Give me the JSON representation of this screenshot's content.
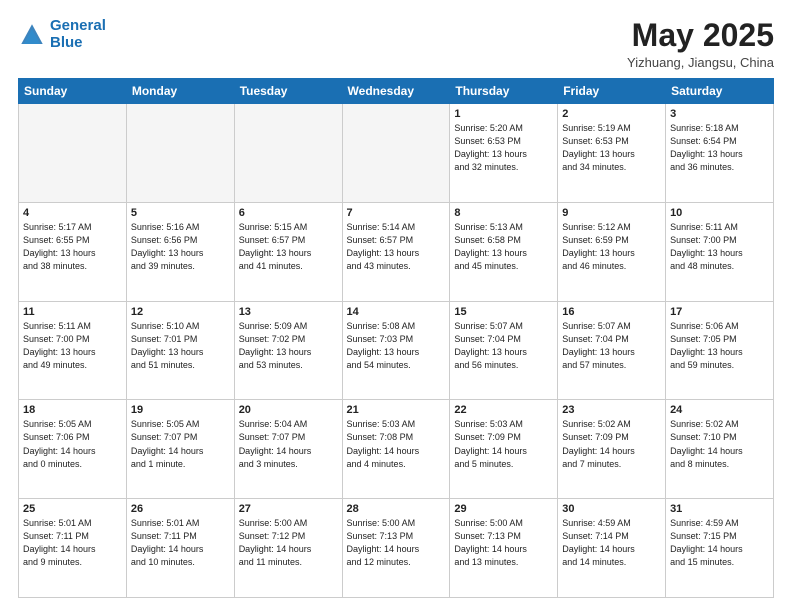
{
  "logo": {
    "line1": "General",
    "line2": "Blue"
  },
  "title": "May 2025",
  "subtitle": "Yizhuang, Jiangsu, China",
  "headers": [
    "Sunday",
    "Monday",
    "Tuesday",
    "Wednesday",
    "Thursday",
    "Friday",
    "Saturday"
  ],
  "weeks": [
    [
      {
        "num": "",
        "info": ""
      },
      {
        "num": "",
        "info": ""
      },
      {
        "num": "",
        "info": ""
      },
      {
        "num": "",
        "info": ""
      },
      {
        "num": "1",
        "info": "Sunrise: 5:20 AM\nSunset: 6:53 PM\nDaylight: 13 hours\nand 32 minutes."
      },
      {
        "num": "2",
        "info": "Sunrise: 5:19 AM\nSunset: 6:53 PM\nDaylight: 13 hours\nand 34 minutes."
      },
      {
        "num": "3",
        "info": "Sunrise: 5:18 AM\nSunset: 6:54 PM\nDaylight: 13 hours\nand 36 minutes."
      }
    ],
    [
      {
        "num": "4",
        "info": "Sunrise: 5:17 AM\nSunset: 6:55 PM\nDaylight: 13 hours\nand 38 minutes."
      },
      {
        "num": "5",
        "info": "Sunrise: 5:16 AM\nSunset: 6:56 PM\nDaylight: 13 hours\nand 39 minutes."
      },
      {
        "num": "6",
        "info": "Sunrise: 5:15 AM\nSunset: 6:57 PM\nDaylight: 13 hours\nand 41 minutes."
      },
      {
        "num": "7",
        "info": "Sunrise: 5:14 AM\nSunset: 6:57 PM\nDaylight: 13 hours\nand 43 minutes."
      },
      {
        "num": "8",
        "info": "Sunrise: 5:13 AM\nSunset: 6:58 PM\nDaylight: 13 hours\nand 45 minutes."
      },
      {
        "num": "9",
        "info": "Sunrise: 5:12 AM\nSunset: 6:59 PM\nDaylight: 13 hours\nand 46 minutes."
      },
      {
        "num": "10",
        "info": "Sunrise: 5:11 AM\nSunset: 7:00 PM\nDaylight: 13 hours\nand 48 minutes."
      }
    ],
    [
      {
        "num": "11",
        "info": "Sunrise: 5:11 AM\nSunset: 7:00 PM\nDaylight: 13 hours\nand 49 minutes."
      },
      {
        "num": "12",
        "info": "Sunrise: 5:10 AM\nSunset: 7:01 PM\nDaylight: 13 hours\nand 51 minutes."
      },
      {
        "num": "13",
        "info": "Sunrise: 5:09 AM\nSunset: 7:02 PM\nDaylight: 13 hours\nand 53 minutes."
      },
      {
        "num": "14",
        "info": "Sunrise: 5:08 AM\nSunset: 7:03 PM\nDaylight: 13 hours\nand 54 minutes."
      },
      {
        "num": "15",
        "info": "Sunrise: 5:07 AM\nSunset: 7:04 PM\nDaylight: 13 hours\nand 56 minutes."
      },
      {
        "num": "16",
        "info": "Sunrise: 5:07 AM\nSunset: 7:04 PM\nDaylight: 13 hours\nand 57 minutes."
      },
      {
        "num": "17",
        "info": "Sunrise: 5:06 AM\nSunset: 7:05 PM\nDaylight: 13 hours\nand 59 minutes."
      }
    ],
    [
      {
        "num": "18",
        "info": "Sunrise: 5:05 AM\nSunset: 7:06 PM\nDaylight: 14 hours\nand 0 minutes."
      },
      {
        "num": "19",
        "info": "Sunrise: 5:05 AM\nSunset: 7:07 PM\nDaylight: 14 hours\nand 1 minute."
      },
      {
        "num": "20",
        "info": "Sunrise: 5:04 AM\nSunset: 7:07 PM\nDaylight: 14 hours\nand 3 minutes."
      },
      {
        "num": "21",
        "info": "Sunrise: 5:03 AM\nSunset: 7:08 PM\nDaylight: 14 hours\nand 4 minutes."
      },
      {
        "num": "22",
        "info": "Sunrise: 5:03 AM\nSunset: 7:09 PM\nDaylight: 14 hours\nand 5 minutes."
      },
      {
        "num": "23",
        "info": "Sunrise: 5:02 AM\nSunset: 7:09 PM\nDaylight: 14 hours\nand 7 minutes."
      },
      {
        "num": "24",
        "info": "Sunrise: 5:02 AM\nSunset: 7:10 PM\nDaylight: 14 hours\nand 8 minutes."
      }
    ],
    [
      {
        "num": "25",
        "info": "Sunrise: 5:01 AM\nSunset: 7:11 PM\nDaylight: 14 hours\nand 9 minutes."
      },
      {
        "num": "26",
        "info": "Sunrise: 5:01 AM\nSunset: 7:11 PM\nDaylight: 14 hours\nand 10 minutes."
      },
      {
        "num": "27",
        "info": "Sunrise: 5:00 AM\nSunset: 7:12 PM\nDaylight: 14 hours\nand 11 minutes."
      },
      {
        "num": "28",
        "info": "Sunrise: 5:00 AM\nSunset: 7:13 PM\nDaylight: 14 hours\nand 12 minutes."
      },
      {
        "num": "29",
        "info": "Sunrise: 5:00 AM\nSunset: 7:13 PM\nDaylight: 14 hours\nand 13 minutes."
      },
      {
        "num": "30",
        "info": "Sunrise: 4:59 AM\nSunset: 7:14 PM\nDaylight: 14 hours\nand 14 minutes."
      },
      {
        "num": "31",
        "info": "Sunrise: 4:59 AM\nSunset: 7:15 PM\nDaylight: 14 hours\nand 15 minutes."
      }
    ]
  ]
}
